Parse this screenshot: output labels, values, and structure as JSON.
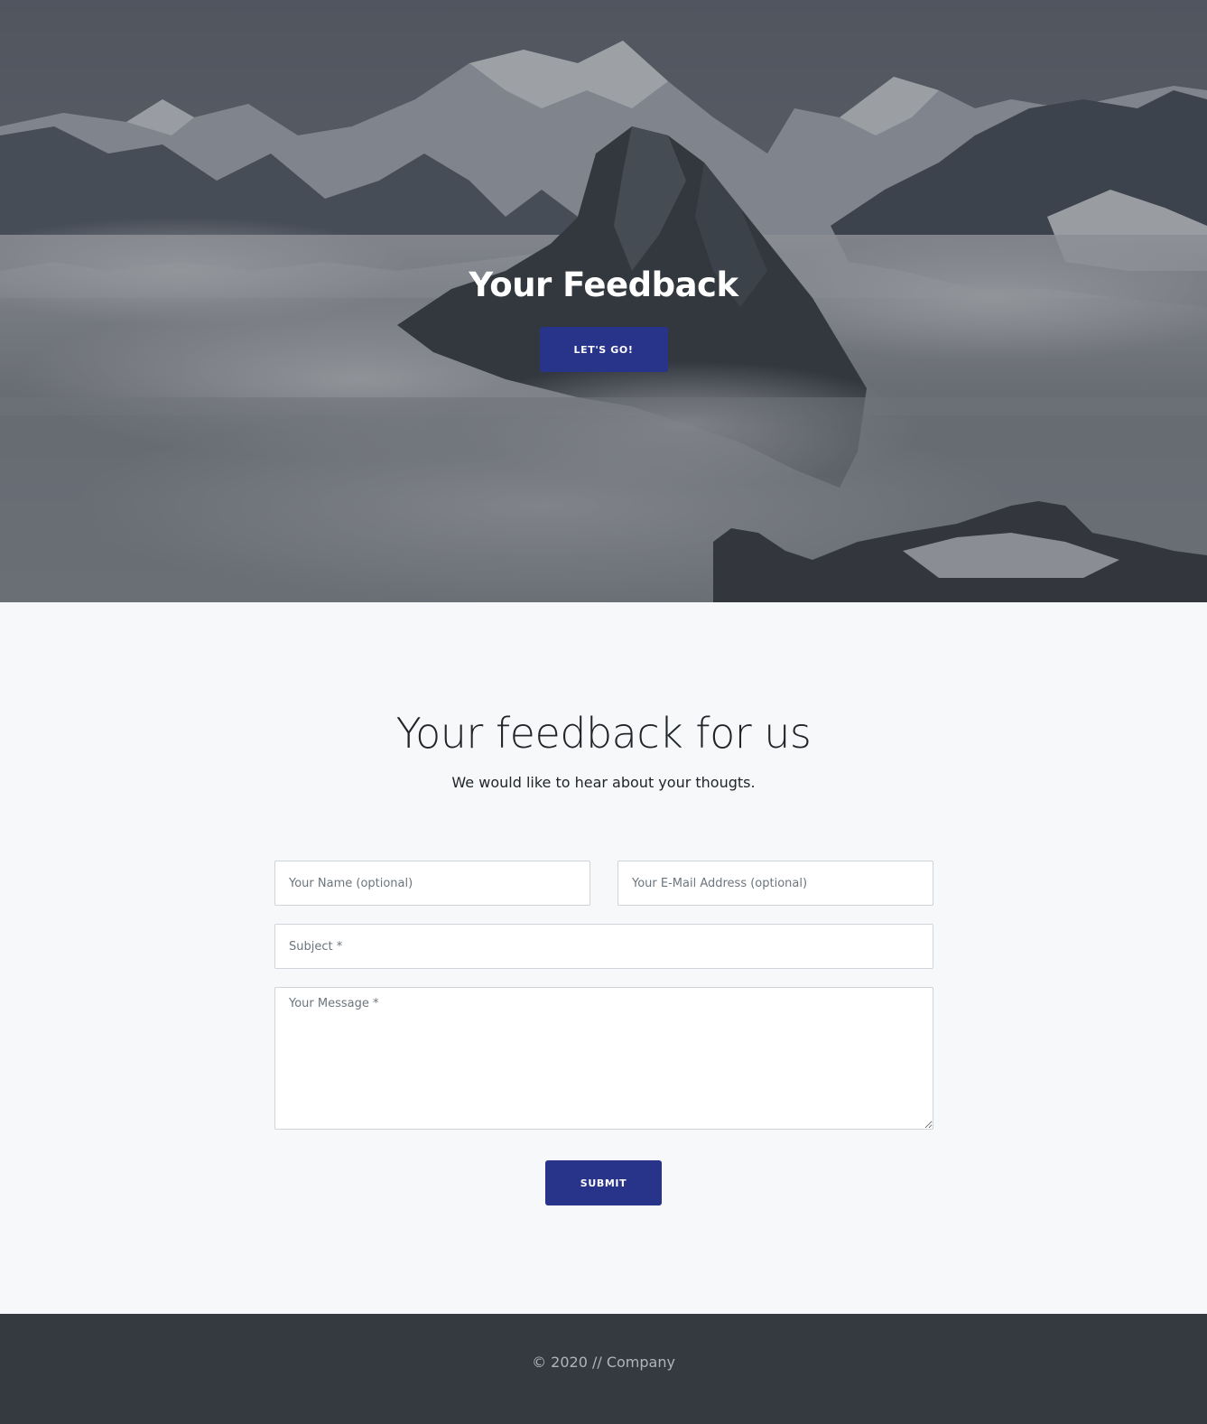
{
  "colors": {
    "accent": "#28338a",
    "section_bg": "#f7f8fa",
    "footer_bg": "#343a40",
    "footer_text": "#adb5bd"
  },
  "hero": {
    "background": "mountain-peaks-in-clouds",
    "title": "Your Feedback",
    "button_label": "LET'S GO!"
  },
  "feedback": {
    "title": "Your feedback for us",
    "subtitle": "We would like to hear about your thougts.",
    "form": {
      "name_placeholder": "Your Name (optional)",
      "email_placeholder": "Your E-Mail Address (optional)",
      "subject_placeholder": "Subject *",
      "message_placeholder": "Your Message *",
      "submit_label": "SUBMIT"
    }
  },
  "footer": {
    "text": "© 2020 // Company"
  }
}
